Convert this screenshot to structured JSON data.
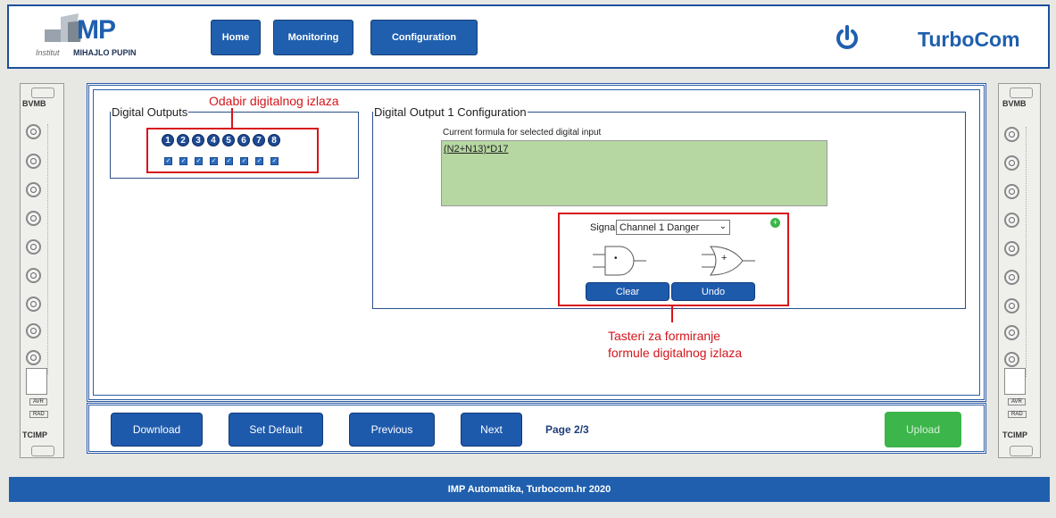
{
  "header": {
    "logo_institut": "Institut",
    "logo_mark": "MP",
    "logo_name": "MIHAJLO PUPIN",
    "nav": [
      "Home",
      "Monitoring",
      "Configuration"
    ],
    "brand": "TurboCom",
    "power_icon": "power-icon"
  },
  "left_rack": {
    "title": "BVMB",
    "bottom": "TCIMP",
    "tags": [
      "AVR",
      "RAD"
    ]
  },
  "right_rack": {
    "title": "BVMB",
    "bottom": "TCIMP",
    "tags": [
      "AVR",
      "RAD"
    ]
  },
  "outputs": {
    "legend": "Digital Outputs",
    "numbers": [
      "1",
      "2",
      "3",
      "4",
      "5",
      "6",
      "7",
      "8"
    ]
  },
  "config": {
    "legend": "Digital Output 1 Configuration",
    "formula_label": "Current formula for selected digital input",
    "formula": "(N2+N13)*D17",
    "signal_label": "Signal:",
    "signal_value": "Channel 1 Danger",
    "and_symbol": "•",
    "or_symbol": "+",
    "clear": "Clear",
    "undo": "Undo"
  },
  "annotations": {
    "outputs_note": "Odabir digitalnog izlaza",
    "buttons_note_1": "Tasteri za formiranje",
    "buttons_note_2": "formule digitalnog izlaza"
  },
  "bottom_bar": {
    "download": "Download",
    "set_default": "Set Default",
    "previous": "Previous",
    "next": "Next",
    "page": "Page 2/3",
    "upload": "Upload"
  },
  "footer": "IMP Automatika, Turbocom.hr 2020",
  "colors": {
    "brand_blue": "#1f5fae",
    "annotation_red": "#d8141b",
    "formula_green": "#b6d7a2",
    "upload_green": "#3cb54a"
  }
}
